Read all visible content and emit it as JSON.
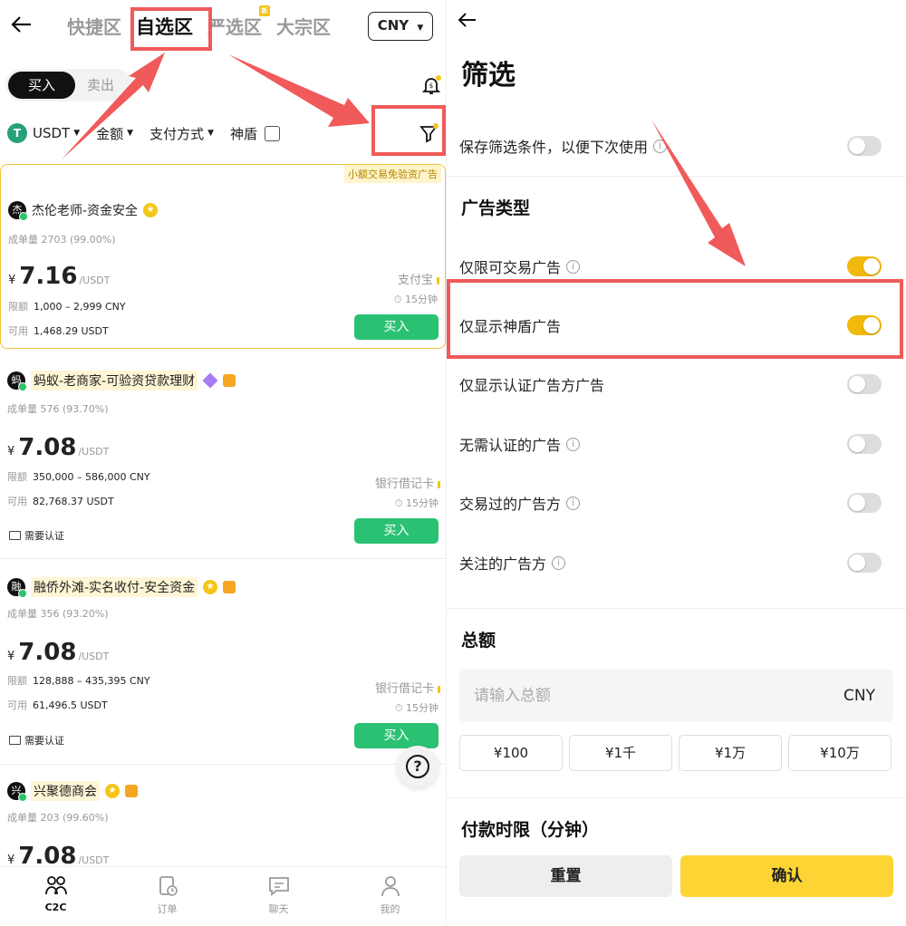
{
  "left": {
    "nav_tabs": [
      "快捷区",
      "自选区",
      "严选区",
      "大宗区"
    ],
    "new_badge": "新",
    "currency": "CNY",
    "buy_tab": "买入",
    "sell_tab": "卖出",
    "filters": {
      "coin": "USDT",
      "coin_logo": "T",
      "amount": "金额",
      "payment": "支付方式",
      "shield": "神盾"
    },
    "ad_tag": "小额交易免验资广告",
    "offers": [
      {
        "avatar": "杰",
        "name": "杰伦老师-资金安全",
        "stats": "成单量 2703 (99.00%)",
        "currency_symbol": "¥",
        "price": "7.16",
        "unit": "/USDT",
        "limit_label": "限额",
        "limit": "1,000 – 2,999 CNY",
        "avail_label": "可用",
        "available": "1,468.29 USDT",
        "payment": "支付宝",
        "time": "15分钟",
        "button": "买入"
      },
      {
        "avatar": "蚂",
        "name": "蚂蚁-老商家-可验资贷款理财",
        "stats": "成单量 576 (93.70%)",
        "currency_symbol": "¥",
        "price": "7.08",
        "unit": "/USDT",
        "limit_label": "限额",
        "limit": "350,000 – 586,000 CNY",
        "avail_label": "可用",
        "available": "82,768.37 USDT",
        "payment": "银行借记卡",
        "time": "15分钟",
        "kyc": "需要认证",
        "button": "买入"
      },
      {
        "avatar": "融",
        "name": "融侨外滩-实名收付-安全资金",
        "stats": "成单量 356 (93.20%)",
        "currency_symbol": "¥",
        "price": "7.08",
        "unit": "/USDT",
        "limit_label": "限额",
        "limit": "128,888 – 435,395 CNY",
        "avail_label": "可用",
        "available": "61,496.5 USDT",
        "payment": "银行借记卡",
        "time": "15分钟",
        "kyc": "需要认证",
        "button": "买入"
      },
      {
        "avatar": "兴",
        "name": "兴聚德商会",
        "stats": "成单量 203 (99.60%)",
        "currency_symbol": "¥",
        "price": "7.08",
        "unit": "/USDT"
      }
    ],
    "help": "?",
    "bottom_nav": [
      "C2C",
      "订单",
      "聊天",
      "我的"
    ]
  },
  "right": {
    "title": "筛选",
    "save_label": "保存筛选条件，以便下次使用",
    "ad_type_title": "广告类型",
    "options": [
      {
        "label": "仅限可交易广告",
        "info": true,
        "on": true
      },
      {
        "label": "仅显示神盾广告",
        "info": false,
        "on": true
      },
      {
        "label": "仅显示认证广告方广告",
        "info": false,
        "on": false
      },
      {
        "label": "无需认证的广告",
        "info": true,
        "on": false
      },
      {
        "label": "交易过的广告方",
        "info": true,
        "on": false
      },
      {
        "label": "关注的广告方",
        "info": true,
        "on": false
      }
    ],
    "total_title": "总额",
    "total_placeholder": "请输入总额",
    "total_currency": "CNY",
    "chips": [
      "¥100",
      "¥1千",
      "¥1万",
      "¥10万"
    ],
    "payment_time_title": "付款时限（分钟）",
    "reset": "重置",
    "confirm": "确认"
  },
  "colors": {
    "accent_yellow": "#fcd535",
    "buy_green": "#2bc173",
    "annotation_red": "#f05a5a"
  }
}
